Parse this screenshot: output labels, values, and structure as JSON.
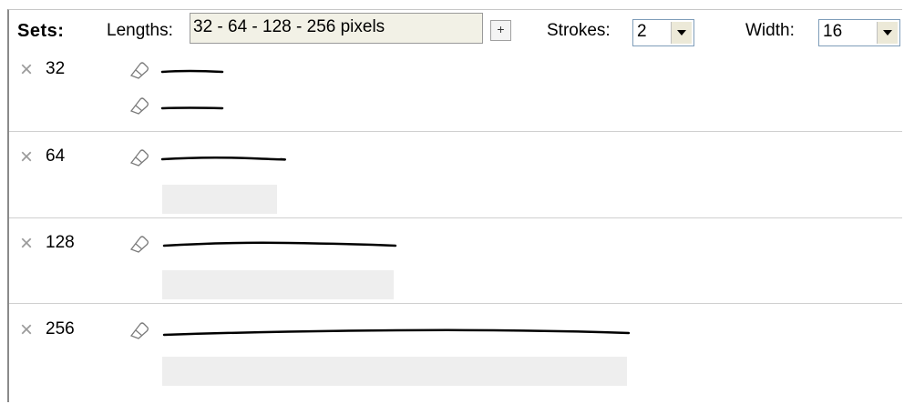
{
  "toolbar": {
    "sets_label": "Sets:",
    "lengths_label": "Lengths:",
    "lengths_value": "32 - 64 - 128 - 256 pixels",
    "add_label": "+",
    "strokes_label": "Strokes:",
    "strokes_value": "2",
    "width_label": "Width:",
    "width_value": "16"
  },
  "sets": [
    {
      "label": "32"
    },
    {
      "label": "64"
    },
    {
      "label": "128"
    },
    {
      "label": "256"
    }
  ],
  "icons": {
    "delete": "close-icon",
    "edit": "eraser-icon"
  }
}
